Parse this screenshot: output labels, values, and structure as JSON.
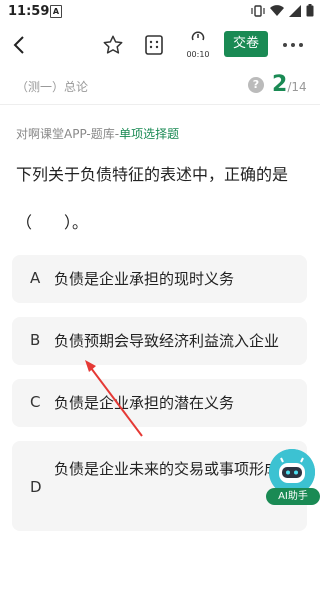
{
  "status_bar": {
    "time": "11:59",
    "app_icon": "A"
  },
  "toolbar": {
    "timer": "00:10",
    "submit_label": "交卷",
    "icons": [
      "back-icon",
      "star-icon",
      "answer-card-icon",
      "timer-icon",
      "more-icon"
    ]
  },
  "subheader": {
    "section": "（测一）总论",
    "current": "2",
    "total": "/14"
  },
  "question": {
    "source": "对啊课堂APP-题库-",
    "type": "单项选择题",
    "stem": "下列关于负债特征的表述中，正确的是（　　）。"
  },
  "options": [
    {
      "letter": "A",
      "text": "负债是企业承担的现时义务"
    },
    {
      "letter": "B",
      "text": "负债预期会导致经济利益流入企业"
    },
    {
      "letter": "C",
      "text": "负债是企业承担的潜在义务"
    },
    {
      "letter": "D",
      "text": "负债是企业未来的交易或事项形成的"
    }
  ],
  "ai_helper": {
    "label": "AI助手"
  },
  "colors": {
    "accent": "#1a8a54",
    "option_bg": "#f5f5f5",
    "arrow": "#e53935"
  }
}
